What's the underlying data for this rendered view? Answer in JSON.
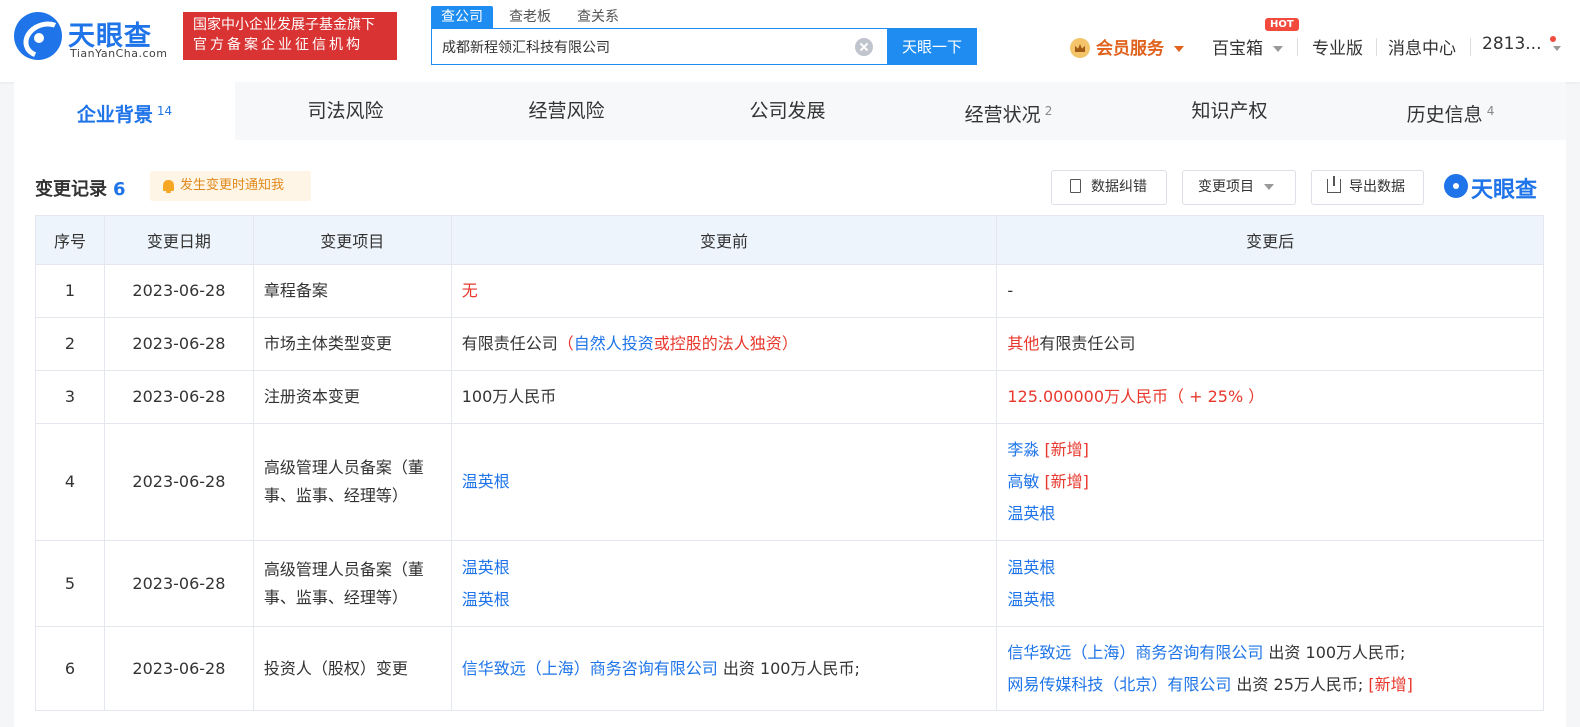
{
  "header": {
    "logo_text": "天眼查",
    "logo_sub": "TianYanCha.com",
    "badge_line1": "国家中小企业发展子基金旗下",
    "badge_line2": "官方备案企业征信机构",
    "search_tabs": [
      "查公司",
      "查老板",
      "查关系"
    ],
    "search_value": "成都新程领汇科技有限公司",
    "search_button": "天眼一下",
    "vip_label": "会员服务",
    "baobao_label": "百宝箱",
    "hot_label": "HOT",
    "pro_label": "专业版",
    "message_label": "消息中心",
    "user_label": "2813..."
  },
  "tabs": [
    {
      "label": "企业背景",
      "count": "14"
    },
    {
      "label": "司法风险",
      "count": ""
    },
    {
      "label": "经营风险",
      "count": ""
    },
    {
      "label": "公司发展",
      "count": ""
    },
    {
      "label": "经营状况",
      "count": "2"
    },
    {
      "label": "知识产权",
      "count": ""
    },
    {
      "label": "历史信息",
      "count": "4"
    }
  ],
  "section": {
    "title": "变更记录",
    "count": "6",
    "notify": "发生变更时通知我",
    "btn_correct": "数据纠错",
    "btn_items": "变更项目",
    "btn_export": "导出数据",
    "brand": "天眼查"
  },
  "table": {
    "headers": [
      "序号",
      "变更日期",
      "变更项目",
      "变更前",
      "变更后"
    ],
    "rows": [
      {
        "no": "1",
        "date": "2023-06-28",
        "item": "章程备案",
        "before_text": "无",
        "after_text": "-"
      },
      {
        "no": "2",
        "date": "2023-06-28",
        "item": "市场主体类型变更",
        "before_a": "有限责任公司",
        "before_b": "（",
        "before_c": "自然人投资",
        "before_d": "或控股的法人独资",
        "before_e": "）",
        "after_a": "其他",
        "after_b": "有限责任公司"
      },
      {
        "no": "3",
        "date": "2023-06-28",
        "item": "注册资本变更",
        "before_text": "100万人民币",
        "after_text": "125.000000万人民币（ + 25% ）"
      },
      {
        "no": "4",
        "date": "2023-06-28",
        "item": "高级管理人员备案（董事、监事、经理等）",
        "before_text": "温英根",
        "after_1": "李淼",
        "after_1_tag": "[新增]",
        "after_2": "高敏",
        "after_2_tag": "[新增]",
        "after_3": "温英根"
      },
      {
        "no": "5",
        "date": "2023-06-28",
        "item": "高级管理人员备案（董事、监事、经理等）",
        "before_1": "温英根",
        "before_2": "温英根",
        "after_1": "温英根",
        "after_2": "温英根"
      },
      {
        "no": "6",
        "date": "2023-06-28",
        "item": "投资人（股权）变更",
        "before_name": "信华致远（上海）商务咨询有限公司",
        "before_amount": " 出资 100万人民币;",
        "after_1_name": "信华致远（上海）商务咨询有限公司",
        "after_1_amount": " 出资 100万人民币;",
        "after_2_name": "网易传媒科技（北京）有限公司",
        "after_2_amount": " 出资 25万人民币; ",
        "after_2_tag": "[新增]"
      }
    ]
  }
}
